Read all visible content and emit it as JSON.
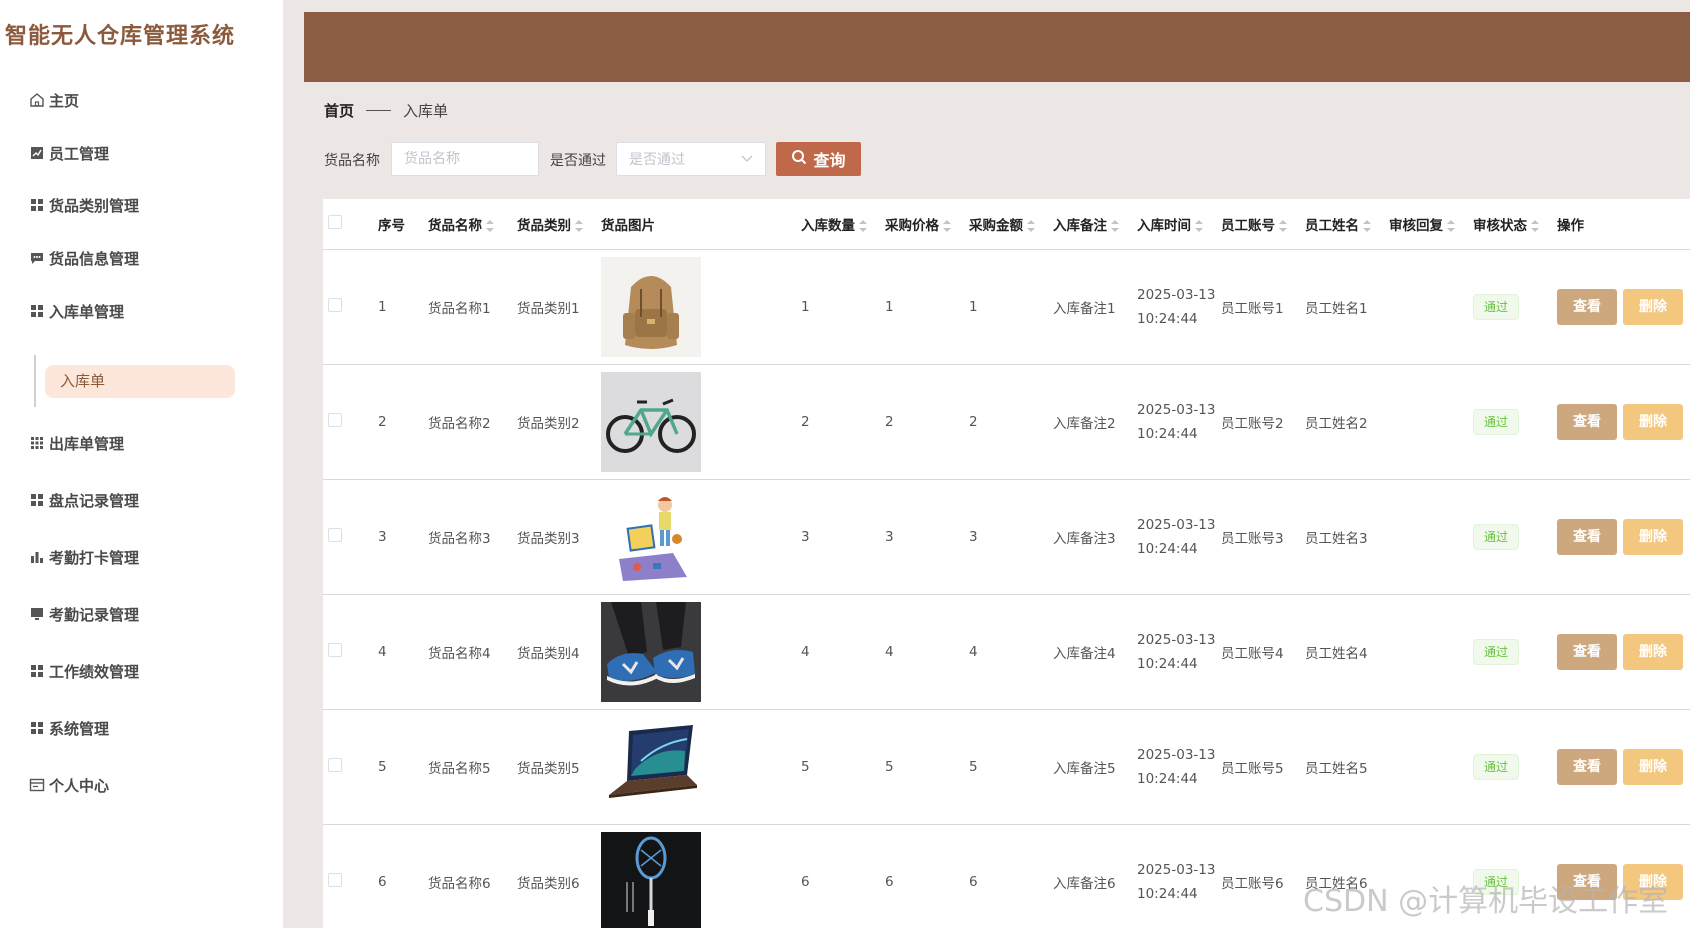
{
  "app_title": "智能无人仓库管理系统",
  "sidebar": {
    "items": [
      {
        "label": "主页",
        "icon": "home-icon"
      },
      {
        "label": "员工管理",
        "icon": "chart-icon"
      },
      {
        "label": "货品类别管理",
        "icon": "grid-icon"
      },
      {
        "label": "货品信息管理",
        "icon": "message-icon"
      },
      {
        "label": "入库单管理",
        "icon": "grid-icon"
      },
      {
        "label": "出库单管理",
        "icon": "grid9-icon"
      },
      {
        "label": "盘点记录管理",
        "icon": "grid-icon"
      },
      {
        "label": "考勤打卡管理",
        "icon": "bar-chart-icon"
      },
      {
        "label": "考勤记录管理",
        "icon": "monitor-icon"
      },
      {
        "label": "工作绩效管理",
        "icon": "grid-icon"
      },
      {
        "label": "系统管理",
        "icon": "grid-icon"
      },
      {
        "label": "个人中心",
        "icon": "calendar-icon"
      }
    ],
    "active_sub": "入库单"
  },
  "breadcrumb": {
    "home": "首页",
    "current": "入库单"
  },
  "search": {
    "name_label": "货品名称",
    "name_placeholder": "货品名称",
    "passed_label": "是否通过",
    "passed_placeholder": "是否通过",
    "button": "查询"
  },
  "table": {
    "headers": [
      "序号",
      "货品名称",
      "货品类别",
      "货品图片",
      "入库数量",
      "采购价格",
      "采购金额",
      "入库备注",
      "入库时间",
      "员工账号",
      "员工姓名",
      "审核回复",
      "审核状态",
      "操作"
    ],
    "rows": [
      {
        "no": "1",
        "name": "货品名称1",
        "category": "货品类别1",
        "image": "backpack",
        "qty": "1",
        "price": "1",
        "amount": "1",
        "remark": "入库备注1",
        "date": "2025-03-13",
        "time": "10:24:44",
        "account": "员工账号1",
        "staff": "员工姓名1",
        "reply": "",
        "status": "通过"
      },
      {
        "no": "2",
        "name": "货品名称2",
        "category": "货品类别2",
        "image": "bicycle",
        "qty": "2",
        "price": "2",
        "amount": "2",
        "remark": "入库备注2",
        "date": "2025-03-13",
        "time": "10:24:44",
        "account": "员工账号2",
        "staff": "员工姓名2",
        "reply": "",
        "status": "通过"
      },
      {
        "no": "3",
        "name": "货品名称3",
        "category": "货品类别3",
        "image": "kids-illustration",
        "qty": "3",
        "price": "3",
        "amount": "3",
        "remark": "入库备注3",
        "date": "2025-03-13",
        "time": "10:24:44",
        "account": "员工账号3",
        "staff": "员工姓名3",
        "reply": "",
        "status": "通过"
      },
      {
        "no": "4",
        "name": "货品名称4",
        "category": "货品类别4",
        "image": "sneakers",
        "qty": "4",
        "price": "4",
        "amount": "4",
        "remark": "入库备注4",
        "date": "2025-03-13",
        "time": "10:24:44",
        "account": "员工账号4",
        "staff": "员工姓名4",
        "reply": "",
        "status": "通过"
      },
      {
        "no": "5",
        "name": "货品名称5",
        "category": "货品类别5",
        "image": "laptop",
        "qty": "5",
        "price": "5",
        "amount": "5",
        "remark": "入库备注5",
        "date": "2025-03-13",
        "time": "10:24:44",
        "account": "员工账号5",
        "staff": "员工姓名5",
        "reply": "",
        "status": "通过"
      },
      {
        "no": "6",
        "name": "货品名称6",
        "category": "货品类别6",
        "image": "badminton-racket",
        "qty": "6",
        "price": "6",
        "amount": "6",
        "remark": "入库备注6",
        "date": "2025-03-13",
        "time": "10:24:44",
        "account": "员工账号6",
        "staff": "员工姓名6",
        "reply": "",
        "status": "通过"
      }
    ],
    "view_label": "查看",
    "delete_label": "删除"
  },
  "watermark": "CSDN @计算机毕设工作室",
  "colors": {
    "brand": "#8b5d44",
    "accent": "#c0694a",
    "view_button": "#cda87e",
    "delete_button": "#f4c77f",
    "active_sub_bg": "#fde6da",
    "status_tag": "#67c23a"
  }
}
